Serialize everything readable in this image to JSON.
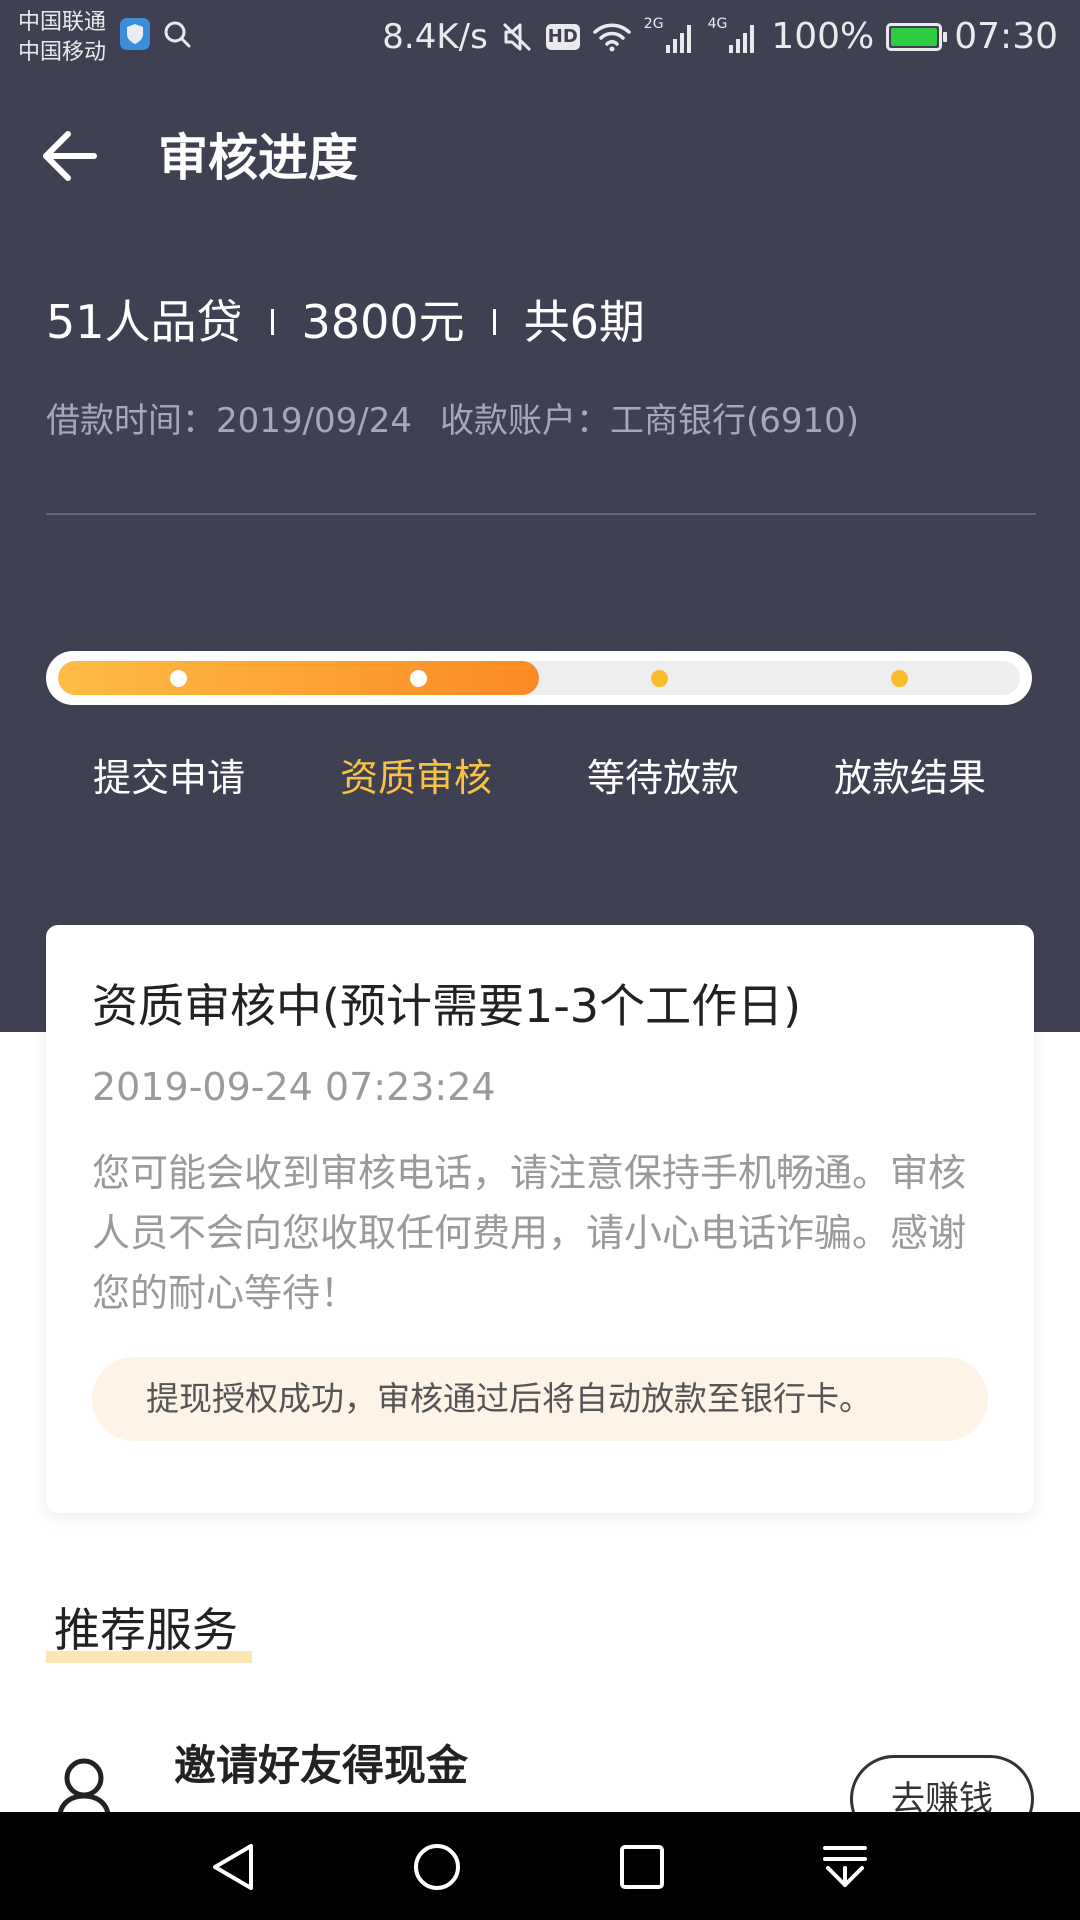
{
  "status_bar": {
    "carrier_1": "中国联通",
    "carrier_2": "中国移动",
    "net_speed": "8.4K/s",
    "hd_label": "HD",
    "sig1_label": "2G",
    "sig2_label": "4G",
    "battery": "100%",
    "time": "07:30",
    "icons": [
      "shield-icon",
      "search-icon",
      "mute-icon",
      "wifi-icon",
      "signal-icon",
      "battery-icon"
    ]
  },
  "header": {
    "title": "审核进度",
    "back_icon": "arrow-left-icon"
  },
  "loan": {
    "product": "51人品贷",
    "amount": "3800元",
    "periods": "共6期",
    "borrow_time": "借款时间：2019/09/24",
    "account": "收款账户：工商银行(6910)"
  },
  "progress": {
    "fill_percent": 50,
    "current_step": 1,
    "steps": [
      {
        "label": "提交申请"
      },
      {
        "label": "资质审核"
      },
      {
        "label": "等待放款"
      },
      {
        "label": "放款结果"
      }
    ]
  },
  "review_card": {
    "title": "资质审核中(预计需要1-3个工作日)",
    "time": "2019-09-24 07:23:24",
    "description": "您可能会收到审核电话，请注意保持手机畅通。审核人员不会向您收取任何费用，请小心电话诈骗。感谢您的耐心等待！",
    "notice": "提现授权成功，审核通过后将自动放款至银行卡。"
  },
  "recommend": {
    "section_title": "推荐服务",
    "items": [
      {
        "name": "邀请好友得现金",
        "button": "去赚钱",
        "icon": "user-icon"
      }
    ]
  },
  "nav_bar": {
    "icons": [
      "back-triangle-icon",
      "home-circle-icon",
      "recents-square-icon",
      "notification-pull-icon"
    ]
  },
  "colors": {
    "header_bg": "#3f4152",
    "accent_orange": "#fb8a24",
    "accent_yellow": "#f9c243",
    "notice_bg": "#fdf4e7"
  }
}
